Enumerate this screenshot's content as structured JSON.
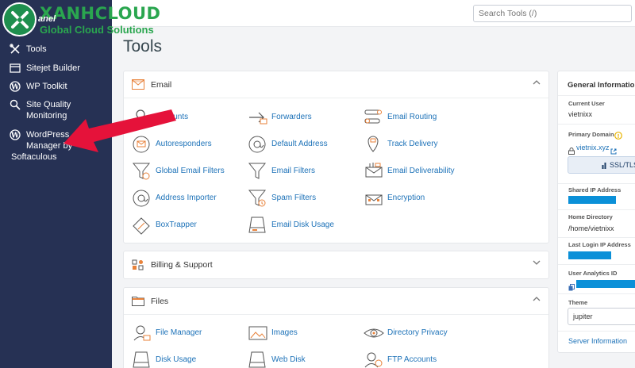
{
  "brand": {
    "name": "XANHCLOUD",
    "tagline": "Global Cloud Solutions",
    "partial_logo_text": "anel"
  },
  "sidebar": {
    "items": [
      {
        "label": "Tools",
        "icon": "tools-icon"
      },
      {
        "label": "Sitejet Builder",
        "icon": "sitejet-icon"
      },
      {
        "label": "WP Toolkit",
        "icon": "wordpress-icon"
      },
      {
        "label_line1": "Site Quality",
        "label_line2": "Monitoring",
        "icon": "search-magnifier-icon"
      },
      {
        "label_line1": "WordPress",
        "label_line2": "Manager by",
        "label_line3": "Softaculous",
        "icon": "wordpress-icon"
      }
    ]
  },
  "search": {
    "placeholder": "Search Tools (/)"
  },
  "page_title": "Tools",
  "sections": {
    "email": {
      "title": "Email",
      "tools": [
        {
          "label": "Accounts",
          "icon": "email-accounts-icon"
        },
        {
          "label": "Forwarders",
          "icon": "forwarders-icon"
        },
        {
          "label": "Email Routing",
          "icon": "email-routing-icon"
        },
        {
          "label": "Autoresponders",
          "icon": "autoresponders-icon"
        },
        {
          "label": "Default Address",
          "icon": "default-address-icon"
        },
        {
          "label": "Track Delivery",
          "icon": "track-delivery-icon"
        },
        {
          "label": "Global Email Filters",
          "icon": "global-filter-icon"
        },
        {
          "label": "Email Filters",
          "icon": "filter-icon"
        },
        {
          "label": "Email Deliverability",
          "icon": "deliverability-icon"
        },
        {
          "label": "Address Importer",
          "icon": "address-importer-icon"
        },
        {
          "label": "Spam Filters",
          "icon": "spam-filter-icon"
        },
        {
          "label": "Encryption",
          "icon": "encryption-icon"
        },
        {
          "label": "BoxTrapper",
          "icon": "boxtrapper-icon"
        },
        {
          "label": "Email Disk Usage",
          "icon": "disk-usage-icon"
        }
      ]
    },
    "billing": {
      "title": "Billing & Support"
    },
    "files": {
      "title": "Files",
      "tools": [
        {
          "label": "File Manager",
          "icon": "file-manager-icon"
        },
        {
          "label": "Images",
          "icon": "images-icon"
        },
        {
          "label": "Directory Privacy",
          "icon": "directory-privacy-icon"
        },
        {
          "label": "Disk Usage",
          "icon": "disk-usage-icon"
        },
        {
          "label": "Web Disk",
          "icon": "web-disk-icon"
        },
        {
          "label": "FTP Accounts",
          "icon": "ftp-accounts-icon"
        }
      ]
    }
  },
  "general_info": {
    "title": "General Information",
    "current_user_label": "Current User",
    "current_user": "vietnixx",
    "primary_domain_label": "Primary Domain",
    "primary_domain": "vietnix.xyz",
    "ssl_button": "SSL/TLS",
    "shared_ip_label": "Shared IP Address",
    "home_dir_label": "Home Directory",
    "home_dir": "/home/vietnixx",
    "last_login_label": "Last Login IP Address",
    "analytics_label": "User Analytics ID",
    "theme_label": "Theme",
    "theme": "jupiter",
    "server_info_link": "Server Information"
  },
  "colors": {
    "sidebar": "#263154",
    "accent": "#1d72b8",
    "brand_green": "#2aa64f",
    "icon_orange": "#e8823a",
    "annotation_arrow": "#e5123a",
    "mask_blue": "#0b90d8"
  }
}
